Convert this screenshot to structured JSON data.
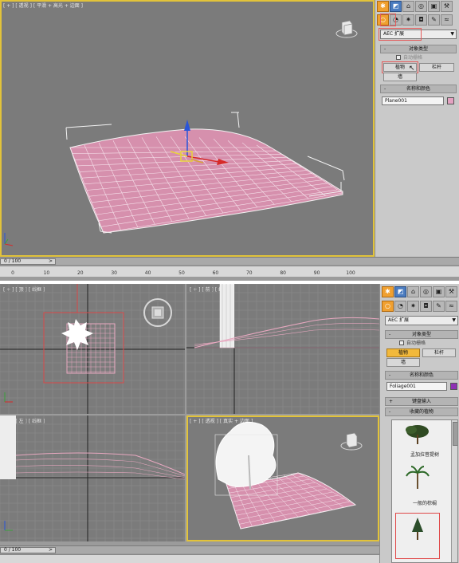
{
  "top": {
    "viewport_label": "[ + ] [ 透视 ] [ 平滑 + 高光 + 边面 ]",
    "frame_counter": "0 / 100",
    "ruler_ticks": [
      "0",
      "10",
      "20",
      "30",
      "40",
      "50",
      "60",
      "70",
      "80",
      "90",
      "100"
    ],
    "panel": {
      "category_dropdown": "AEC 扩展",
      "object_type_header": "对象类型",
      "autogrid_label": "自动栅格",
      "buttons": [
        "植物",
        "栏杆",
        "墙"
      ],
      "active_button": "植物",
      "name_color_header": "名称和颜色",
      "object_name": "Plane001",
      "color": "#e4a2c1"
    }
  },
  "bottom": {
    "top_viewport_label": "[ + ] [ 顶 ] [ 线框 ]",
    "front_viewport_label": "[ + ] [ 前 ] [ 线框 ]",
    "left_viewport_label": "[ + ] [ 左 ] [ 线框 ]",
    "persp_viewport_label": "[ + ] [ 透视 ] [ 真实 + 边面 ]",
    "frame_counter": "0 / 100",
    "panel": {
      "category_dropdown": "AEC 扩展",
      "object_type_header": "对象类型",
      "autogrid_label": "自动栅格",
      "buttons": [
        "植物",
        "栏杆",
        "墙"
      ],
      "active_button": "植物",
      "name_color_header": "名称和颜色",
      "object_name": "Foliage001",
      "color": "#8e2fb3",
      "keyboard_header": "键盘输入",
      "favorites_header": "收藏的植物",
      "plants": [
        "孟加拉菩提树",
        "一般的棕榈"
      ]
    }
  },
  "colors": {
    "accent_orange": "#f2b93c",
    "viewport_border": "#e2c33a",
    "mesh_pink": "#e19ab6",
    "selection_red": "#e04848"
  }
}
